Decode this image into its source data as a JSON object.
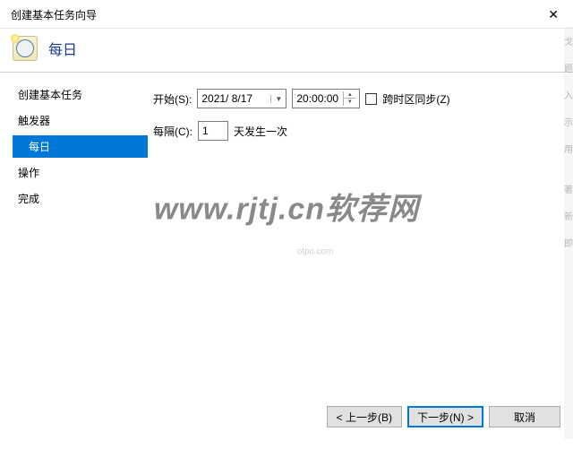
{
  "window": {
    "title": "创建基本任务向导"
  },
  "header": {
    "title": "每日"
  },
  "sidebar": {
    "items": [
      {
        "label": "创建基本任务",
        "sub": false,
        "active": false
      },
      {
        "label": "触发器",
        "sub": false,
        "active": false
      },
      {
        "label": "每日",
        "sub": true,
        "active": true
      },
      {
        "label": "操作",
        "sub": false,
        "active": false
      },
      {
        "label": "完成",
        "sub": false,
        "active": false
      }
    ]
  },
  "form": {
    "start_label": "开始(S):",
    "date_value": "2021/ 8/17",
    "time_value": "20:00:00",
    "timezone_sync_label": "跨时区同步(Z)",
    "timezone_sync_checked": false,
    "interval_label": "每隔(C):",
    "interval_value": "1",
    "interval_suffix": "天发生一次"
  },
  "buttons": {
    "back": "< 上一步(B)",
    "next": "下一步(N) >",
    "cancel": "取消"
  },
  "watermark": {
    "main": "www.rjtj.cn软荐网",
    "sub": "otpc.com"
  },
  "edge_chars": [
    "戈",
    "题",
    "入",
    "示",
    "用",
    "",
    "著",
    "新",
    "即"
  ]
}
